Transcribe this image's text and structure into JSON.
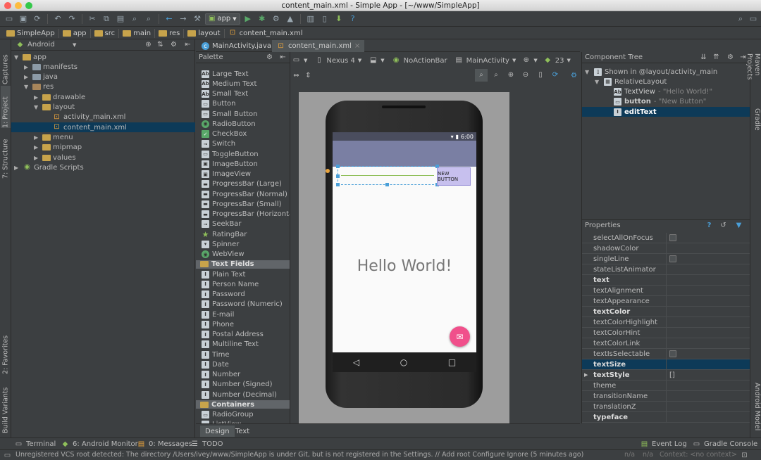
{
  "window": {
    "title": "content_main.xml - Simple App - [~/www/SimpleApp]"
  },
  "toolbar": {
    "run_config": "app"
  },
  "breadcrumb": [
    "SimpleApp",
    "app",
    "src",
    "main",
    "res",
    "layout",
    "content_main.xml"
  ],
  "project": {
    "view_mode": "Android",
    "tree": [
      {
        "label": "app",
        "level": 0,
        "open": true
      },
      {
        "label": "manifests",
        "level": 1
      },
      {
        "label": "java",
        "level": 1
      },
      {
        "label": "res",
        "level": 1,
        "open": true
      },
      {
        "label": "drawable",
        "level": 2
      },
      {
        "label": "layout",
        "level": 2,
        "open": true
      },
      {
        "label": "activity_main.xml",
        "level": 3
      },
      {
        "label": "content_main.xml",
        "level": 3,
        "selected": true
      },
      {
        "label": "menu",
        "level": 2
      },
      {
        "label": "mipmap",
        "level": 2
      },
      {
        "label": "values",
        "level": 2
      },
      {
        "label": "Gradle Scripts",
        "level": 0
      }
    ]
  },
  "left_strip": [
    "1: Project",
    "7: Structure",
    "Captures",
    "2: Favorites",
    "Build Variants"
  ],
  "right_strip": [
    "Maven Projects",
    "Gradle",
    "Android Model"
  ],
  "editor_tabs": [
    {
      "label": "MainActivity.java",
      "icon": "c-class-icon"
    },
    {
      "label": "content_main.xml",
      "icon": "xml-icon",
      "active": true
    }
  ],
  "palette": {
    "title": "Palette",
    "widgets": [
      "Large Text",
      "Medium Text",
      "Small Text",
      "Button",
      "Small Button",
      "RadioButton",
      "CheckBox",
      "Switch",
      "ToggleButton",
      "ImageButton",
      "ImageView",
      "ProgressBar (Large)",
      "ProgressBar (Normal)",
      "ProgressBar (Small)",
      "ProgressBar (Horizontal)",
      "SeekBar",
      "RatingBar",
      "Spinner",
      "WebView"
    ],
    "text_fields_group": "Text Fields",
    "text_fields": [
      "Plain Text",
      "Person Name",
      "Password",
      "Password (Numeric)",
      "E-mail",
      "Phone",
      "Postal Address",
      "Multiline Text",
      "Time",
      "Date",
      "Number",
      "Number (Signed)",
      "Number (Decimal)"
    ],
    "containers_group": "Containers",
    "containers": [
      "RadioGroup",
      "ListView"
    ]
  },
  "design_toolbar": {
    "device": "Nexus 4",
    "theme": "NoActionBar",
    "activity": "MainActivity",
    "api": "23"
  },
  "preview": {
    "time": "6:00",
    "button_text": "NEW BUTTON",
    "hello": "Hello World!"
  },
  "component_tree": {
    "title": "Component Tree",
    "items": [
      {
        "label": "Shown in @layout/activity_main",
        "level": 0
      },
      {
        "label": "RelativeLayout",
        "level": 1
      },
      {
        "label": "TextView",
        "extra": "- \"Hello World!\"",
        "level": 2
      },
      {
        "label": "button",
        "extra": "- \"New Button\"",
        "level": 2
      },
      {
        "label": "editText",
        "extra": "",
        "level": 2,
        "selected": true
      }
    ]
  },
  "properties": {
    "title": "Properties",
    "rows": [
      {
        "name": "selectAllOnFocus",
        "value": "",
        "checkbox": true
      },
      {
        "name": "shadowColor",
        "value": ""
      },
      {
        "name": "singleLine",
        "value": "",
        "checkbox": true
      },
      {
        "name": "stateListAnimator",
        "value": ""
      },
      {
        "name": "text",
        "value": "",
        "bold": true
      },
      {
        "name": "textAlignment",
        "value": ""
      },
      {
        "name": "textAppearance",
        "value": ""
      },
      {
        "name": "textColor",
        "value": "",
        "bold": true
      },
      {
        "name": "textColorHighlight",
        "value": ""
      },
      {
        "name": "textColorHint",
        "value": ""
      },
      {
        "name": "textColorLink",
        "value": ""
      },
      {
        "name": "textIsSelectable",
        "value": "",
        "checkbox": true
      },
      {
        "name": "textSize",
        "value": "",
        "bold": true,
        "selected": true
      },
      {
        "name": "textStyle",
        "value": "[]",
        "bold": true,
        "expandable": true
      },
      {
        "name": "theme",
        "value": ""
      },
      {
        "name": "transitionName",
        "value": ""
      },
      {
        "name": "translationZ",
        "value": ""
      },
      {
        "name": "typeface",
        "value": "",
        "bold": true
      }
    ]
  },
  "bottom_tabs": [
    "Design",
    "Text"
  ],
  "tool_windows": {
    "left": [
      "Terminal",
      "6: Android Monitor",
      "0: Messages",
      "TODO"
    ],
    "right": [
      "Event Log",
      "Gradle Console"
    ]
  },
  "status": {
    "message": "Unregistered VCS root detected: The directory /Users/ivey/www/SimpleApp is under Git, but is not registered in the Settings. // Add root  Configure  Ignore (5 minutes ago)",
    "pos1": "n/a",
    "pos2": "n/a",
    "context": "Context: <no context>"
  }
}
